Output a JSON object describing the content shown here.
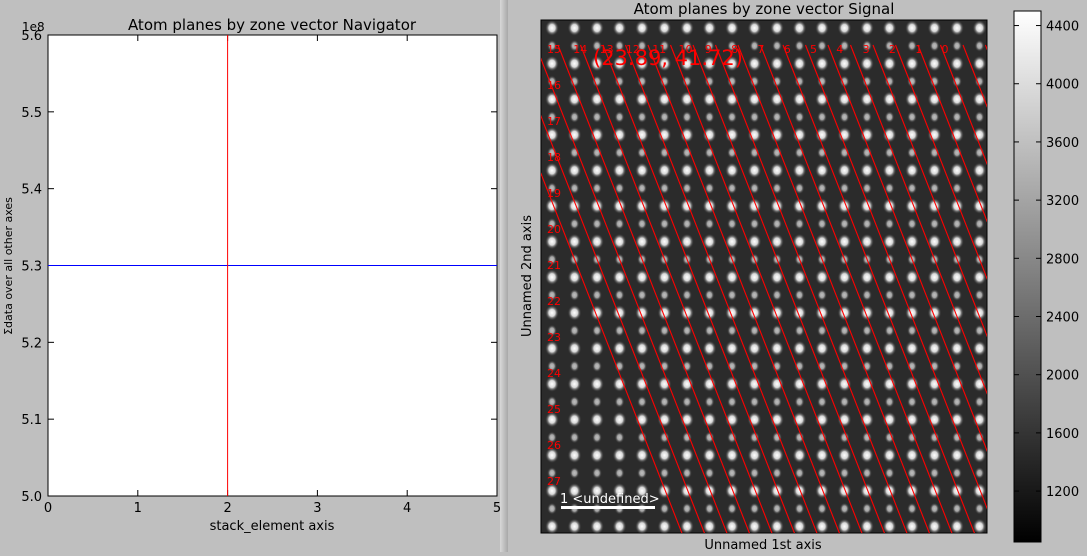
{
  "chart_data": [
    {
      "type": "line",
      "title": "Atom planes by zone vector Navigator",
      "xlabel": "stack_element axis",
      "ylabel": "Σdata over all other axes",
      "y_offset_label": "1e8",
      "xlim": [
        0,
        5
      ],
      "ylim": [
        5.0,
        5.6
      ],
      "xticks": [
        "0",
        "1",
        "2",
        "3",
        "4",
        "5"
      ],
      "yticks": [
        "5.0",
        "5.1",
        "5.2",
        "5.3",
        "5.4",
        "5.5",
        "5.6"
      ],
      "series": [
        {
          "x": [
            0,
            5
          ],
          "y": [
            5.3,
            5.3
          ],
          "color": "#0000ff"
        }
      ],
      "vline": {
        "x": 2,
        "color": "#ff0000"
      },
      "grid": false
    },
    {
      "type": "heatmap",
      "title": "Atom planes by zone vector Signal",
      "xlabel": "Unnamed 1st axis",
      "ylabel": "Unnamed 2nd axis",
      "colormap": "gray",
      "colorbar_ticks": [
        "1200",
        "1600",
        "2000",
        "2400",
        "2800",
        "3200",
        "3600",
        "4000",
        "4400"
      ],
      "colorbar_range": [
        850,
        4500
      ],
      "annotation": "(23.89, 41.72)",
      "scalebar_label": "1 <undefined>",
      "plane_labels_top": [
        "15",
        "14",
        "13",
        "12",
        "11",
        "10",
        "9",
        "8",
        "7",
        "6",
        "5",
        "4",
        "3",
        "2",
        "1",
        "0"
      ],
      "plane_labels_left": [
        "16",
        "17",
        "18",
        "19",
        "20",
        "21",
        "22",
        "23",
        "24",
        "25",
        "26",
        "27"
      ],
      "line_color": "#ff0000"
    }
  ]
}
